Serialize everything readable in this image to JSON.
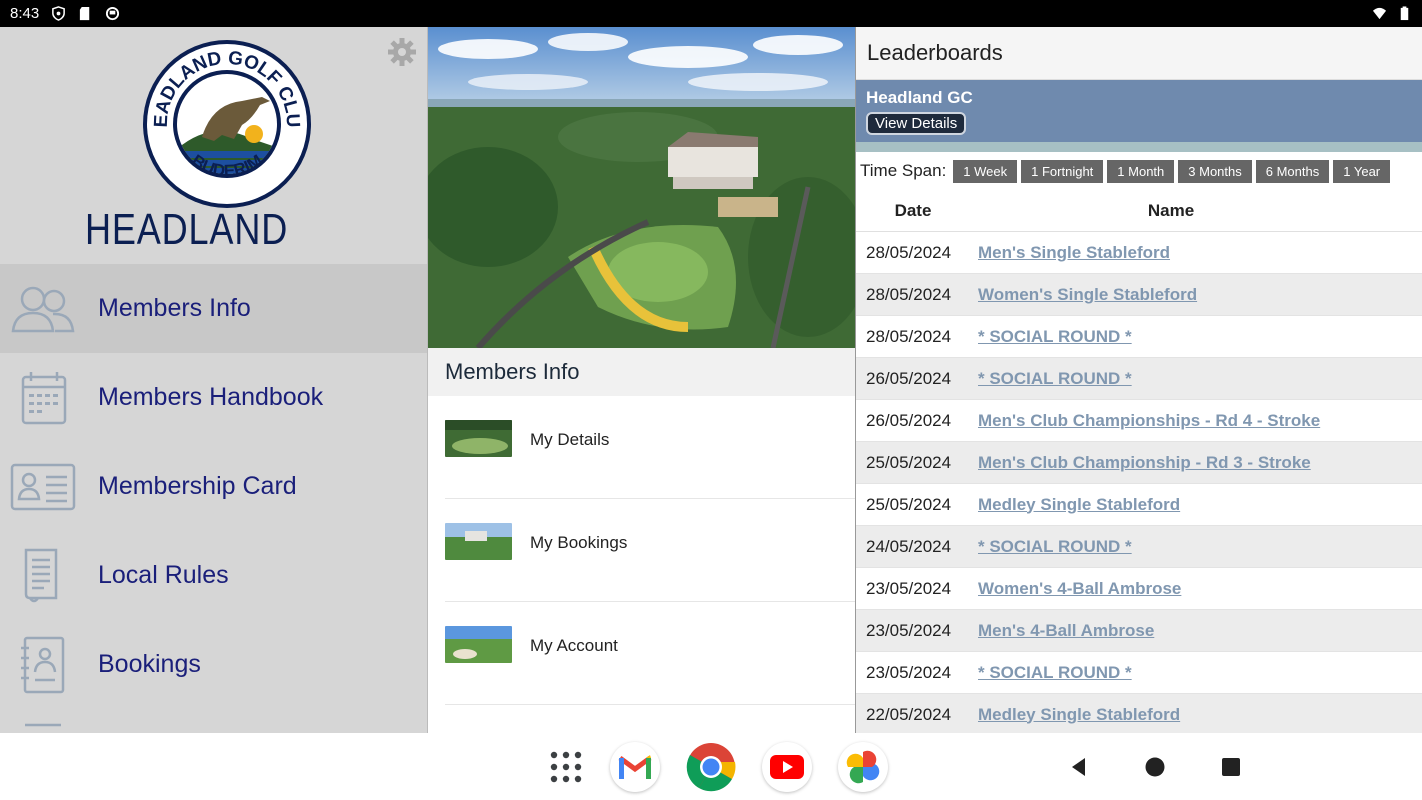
{
  "status_bar": {
    "time": "8:43"
  },
  "sidebar": {
    "brand": "HEADLAND",
    "badge_top": "HEADLAND GOLF CLUB",
    "badge_bottom": "BUDERIM",
    "items": [
      {
        "label": "Members Info",
        "icon": "members-icon",
        "active": true
      },
      {
        "label": "Members Handbook",
        "icon": "calendar-icon",
        "active": false
      },
      {
        "label": "Membership Card",
        "icon": "id-card-icon",
        "active": false
      },
      {
        "label": "Local Rules",
        "icon": "document-icon",
        "active": false
      },
      {
        "label": "Bookings",
        "icon": "booking-icon",
        "active": false
      }
    ]
  },
  "middle": {
    "title": "Members Info",
    "items": [
      {
        "label": "My Details"
      },
      {
        "label": "My Bookings"
      },
      {
        "label": "My Account"
      }
    ]
  },
  "leaderboards": {
    "title": "Leaderboards",
    "club_name": "Headland GC",
    "view_details": "View Details",
    "time_span_label": "Time Span:",
    "time_spans": [
      "1 Week",
      "1 Fortnight",
      "1 Month",
      "3 Months",
      "6 Months",
      "1 Year"
    ],
    "columns": {
      "date": "Date",
      "name": "Name"
    },
    "rows": [
      {
        "date": "28/05/2024",
        "name": "Men's Single Stableford"
      },
      {
        "date": "28/05/2024",
        "name": "Women's Single Stableford"
      },
      {
        "date": "28/05/2024",
        "name": "* SOCIAL ROUND *"
      },
      {
        "date": "26/05/2024",
        "name": "* SOCIAL ROUND *"
      },
      {
        "date": "26/05/2024",
        "name": "Men's Club Championships - Rd 4 - Stroke"
      },
      {
        "date": "25/05/2024",
        "name": "Men's Club Championship - Rd 3 - Stroke"
      },
      {
        "date": "25/05/2024",
        "name": "Medley Single Stableford"
      },
      {
        "date": "24/05/2024",
        "name": "* SOCIAL ROUND *"
      },
      {
        "date": "23/05/2024",
        "name": "Women's 4-Ball Ambrose"
      },
      {
        "date": "23/05/2024",
        "name": "Men's 4-Ball Ambrose"
      },
      {
        "date": "23/05/2024",
        "name": "* SOCIAL ROUND *"
      },
      {
        "date": "22/05/2024",
        "name": "Medley Single Stableford"
      }
    ]
  },
  "nav_bar": {
    "apps": [
      "app-drawer-icon",
      "gmail-icon",
      "chrome-icon",
      "youtube-icon",
      "photos-icon"
    ],
    "buttons": [
      "back-icon",
      "home-icon",
      "recents-icon"
    ]
  },
  "colors": {
    "sidebar_bg": "#d6d6d6",
    "nav_text": "#1a1f7a",
    "club_bar": "#6f8aae",
    "link": "#8097b0"
  }
}
